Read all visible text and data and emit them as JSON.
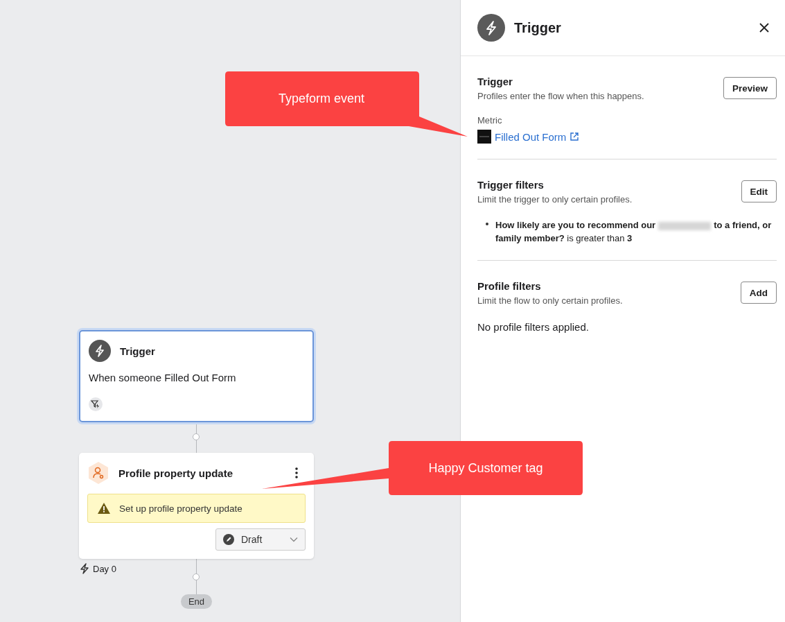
{
  "canvas": {
    "trigger_node": {
      "title": "Trigger",
      "description": "When someone Filled Out Form",
      "selected": true
    },
    "action_node": {
      "title": "Profile property update",
      "warning": "Set up profile property update",
      "status": "Draft",
      "delay": "Day 0"
    },
    "end_label": "End",
    "callouts": [
      {
        "text": "Typeform event",
        "color": "#fb4242"
      },
      {
        "text": "Happy Customer tag",
        "color": "#fb4242"
      }
    ]
  },
  "panel": {
    "title": "Trigger",
    "trigger": {
      "heading": "Trigger",
      "subtitle": "Profiles enter the flow when this happens.",
      "button": "Preview",
      "metric_label": "Metric",
      "metric_link": "Filled Out Form"
    },
    "trigger_filters": {
      "heading": "Trigger filters",
      "subtitle": "Limit the trigger to only certain profiles.",
      "button": "Edit",
      "filter_before": "**How likely are you to recommend our**",
      "filter_after": "**to a friend, or family member?** is greater than **3**"
    },
    "profile_filters": {
      "heading": "Profile filters",
      "subtitle": "Limit the flow to only certain profiles.",
      "button": "Add",
      "empty": "No profile filters applied."
    }
  }
}
